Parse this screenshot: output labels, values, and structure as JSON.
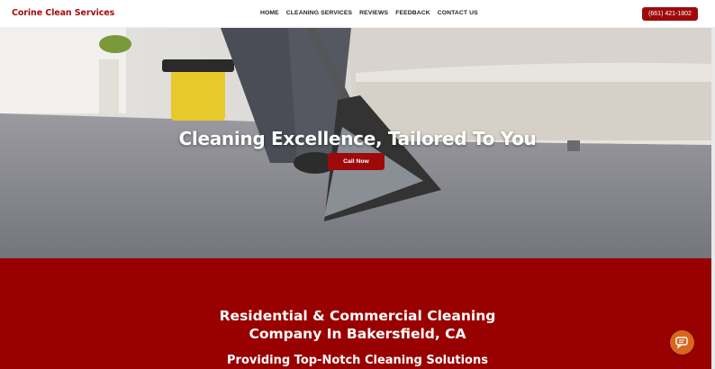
{
  "header": {
    "logo": "Corine Clean Services",
    "nav": [
      "HOME",
      "CLEANING SERVICES",
      "REVIEWS",
      "FEEDBACK",
      "CONTACT US"
    ],
    "phone": "(661) 421-1802"
  },
  "hero": {
    "title": "Cleaning Excellence, Tailored To You",
    "cta": "Call Now"
  },
  "intro": {
    "heading_line1": "Residential & Commercial Cleaning",
    "heading_line2": "Company In Bakersfield, CA",
    "subheading": "Providing Top-Notch Cleaning Solutions"
  },
  "icons": {
    "chat": "chat-icon"
  },
  "colors": {
    "brand_red": "#990000",
    "chat_orange": "#d9661e"
  }
}
